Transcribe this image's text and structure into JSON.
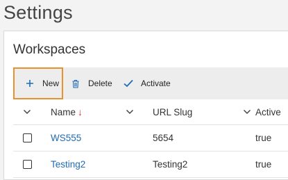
{
  "page": {
    "title": "Settings"
  },
  "section": {
    "title": "Workspaces"
  },
  "toolbar": {
    "new_label": "New",
    "delete_label": "Delete",
    "activate_label": "Activate"
  },
  "icons": {
    "new": "plus-icon",
    "delete": "trash-icon",
    "activate": "checkmark-icon",
    "select_all": "chevron-down-icon",
    "column_menu": "chevron-down-icon",
    "sort": "arrow-down-icon"
  },
  "colors": {
    "accent": "#1f6bb5",
    "highlight_border": "#e8912f",
    "sort_arrow": "#d9393a",
    "link": "#1f6bb5"
  },
  "table": {
    "columns": [
      {
        "label": "Name",
        "sorted": "descending"
      },
      {
        "label": "URL Slug"
      },
      {
        "label": "Active"
      }
    ],
    "rows": [
      {
        "name": "WS555",
        "slug": "5654",
        "active": "true",
        "checked": false
      },
      {
        "name": "Testing2",
        "slug": "Testing2",
        "active": "true",
        "checked": false
      }
    ]
  }
}
